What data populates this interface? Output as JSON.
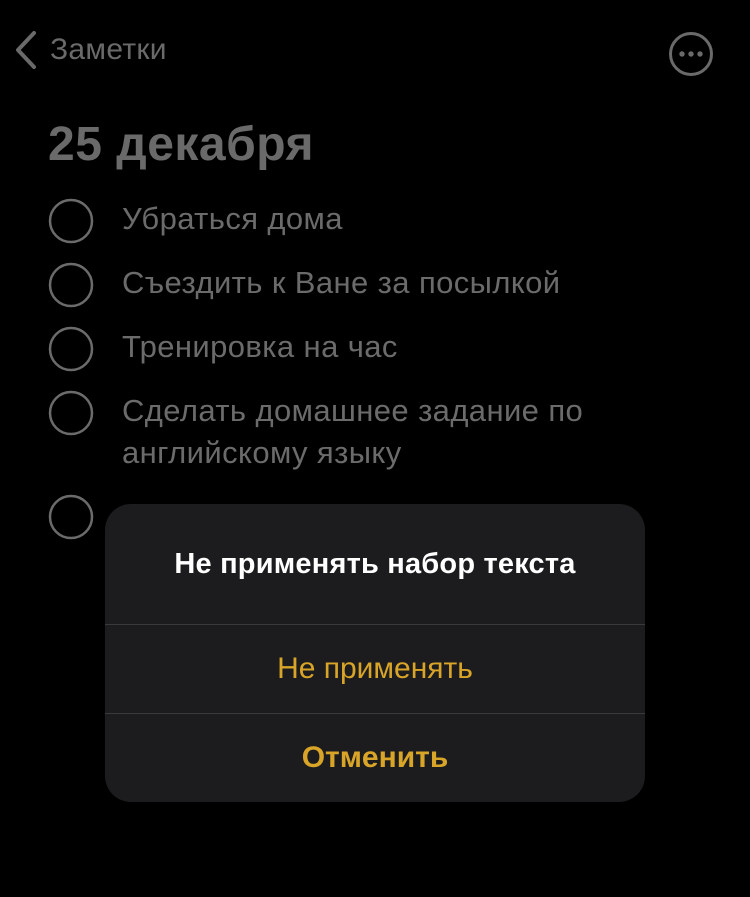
{
  "colors": {
    "background": "#000000",
    "dimmed_text": "#6b6b6b",
    "alert_background": "#1c1c1e",
    "alert_title": "#ffffff",
    "accent": "#d9a528",
    "divider": "#3a3a3c"
  },
  "nav": {
    "back_label": "Заметки",
    "back_icon": "chevron-left-icon",
    "more_icon": "ellipsis-circle-icon"
  },
  "note": {
    "title": "25 декабря",
    "items": [
      {
        "text": "Убраться дома",
        "checked": false
      },
      {
        "text": "Съездить к Ване за посылкой",
        "checked": false
      },
      {
        "text": "Тренировка на час",
        "checked": false
      },
      {
        "text": "Сделать домашнее задание по английскому языку",
        "checked": false
      },
      {
        "text": "",
        "checked": false
      }
    ]
  },
  "alert": {
    "title": "Не применять набор текста",
    "primary_label": "Не применять",
    "cancel_label": "Отменить"
  }
}
